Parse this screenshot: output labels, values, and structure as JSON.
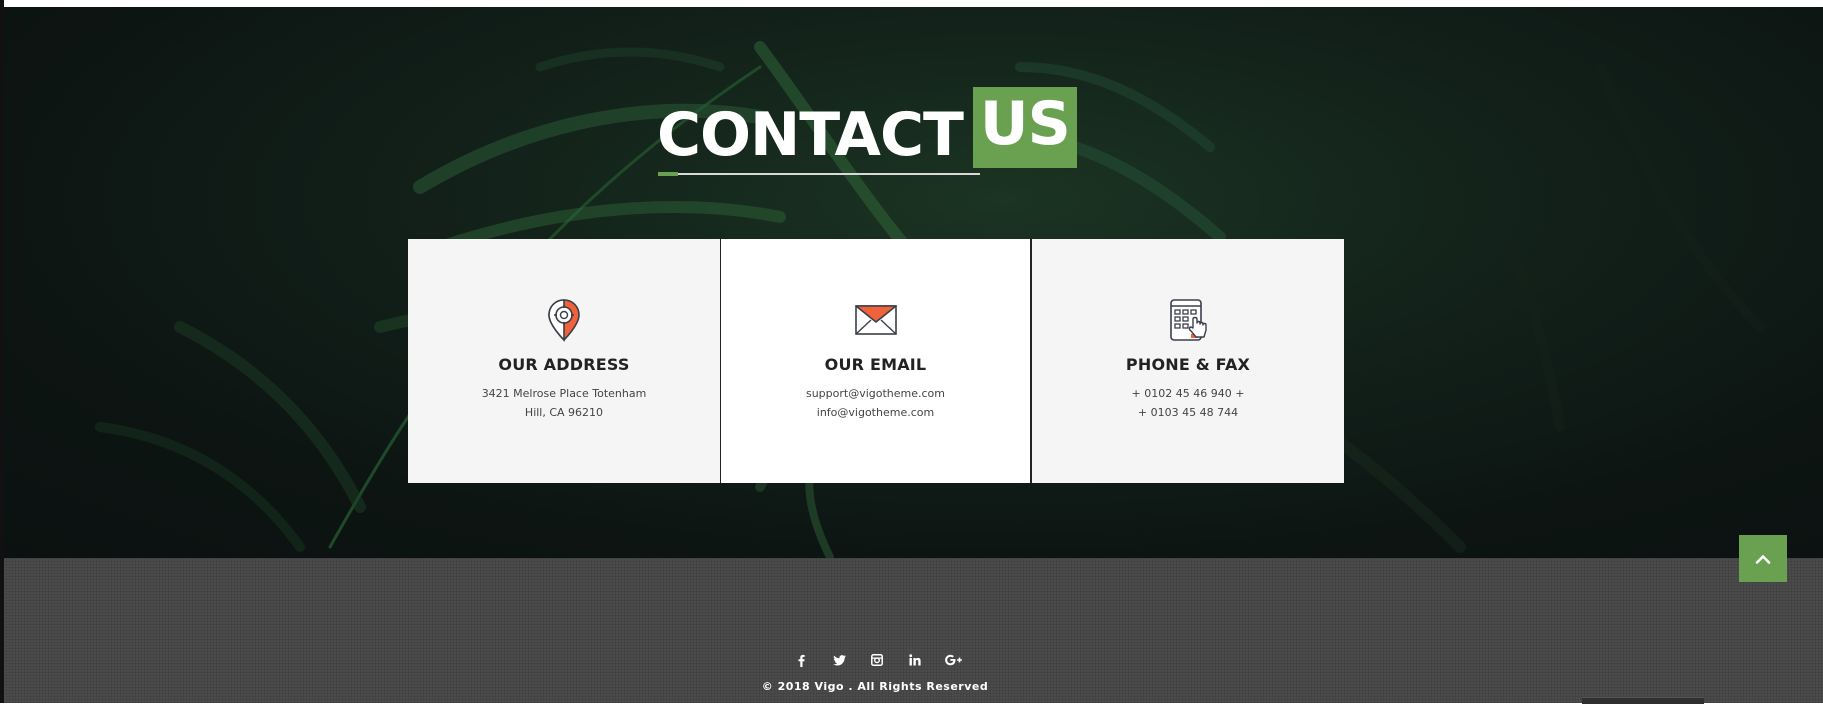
{
  "contact": {
    "title_main": "CONTACT",
    "title_accent": "US",
    "cards": [
      {
        "icon": "map-pin-gear-icon",
        "title": "OUR ADDRESS",
        "lines": [
          "3421 Melrose Place Totenham",
          "Hill, CA 96210"
        ]
      },
      {
        "icon": "envelope-icon",
        "title": "OUR EMAIL",
        "lines": [
          "support@vigotheme.com",
          "info@vigotheme.com"
        ]
      },
      {
        "icon": "phone-keypad-icon",
        "title": "PHONE & FAX",
        "lines": [
          "+ 0102 45 46 940 +",
          "+ 0103 45 48 744"
        ]
      }
    ]
  },
  "footer": {
    "social_icons": [
      "facebook-icon",
      "twitter-icon",
      "instagram-icon",
      "linkedin-icon",
      "google-plus-icon"
    ],
    "copyright": "© 2018 Vigo . All Rights Reserved"
  },
  "colors": {
    "accent_green": "#6aa150",
    "icon_orange": "#f0623a",
    "section_bg": "#0d1513",
    "footer_bg": "#4b4b4b"
  }
}
